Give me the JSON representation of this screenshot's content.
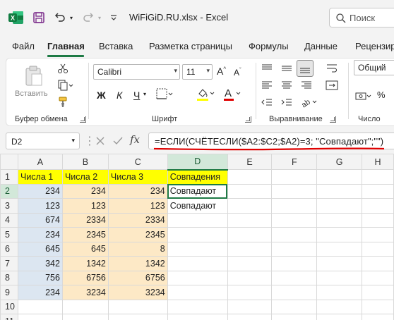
{
  "titlebar": {
    "title": "WiFiGiD.RU.xlsx  -  Excel",
    "search_placeholder": "Поиск"
  },
  "menu": {
    "items": [
      "Файл",
      "Главная",
      "Вставка",
      "Разметка страницы",
      "Формулы",
      "Данные",
      "Рецензиро"
    ],
    "active": "Главная"
  },
  "ribbon": {
    "clipboard": {
      "paste_label": "Вставить",
      "group_label": "Буфер обмена"
    },
    "font": {
      "font_name": "Calibri",
      "font_size": "11",
      "bold": "Ж",
      "italic": "К",
      "underline": "Ч",
      "group_label": "Шрифт",
      "font_color": "#e00000"
    },
    "alignment": {
      "group_label": "Выравнивание"
    },
    "number": {
      "format": "Общий",
      "group_label": "Число"
    }
  },
  "formula_bar": {
    "name_box": "D2",
    "formula": "=ЕСЛИ(СЧЁТЕСЛИ($A2:$C2;$A2)=3; \"Совпадают\";\"\")"
  },
  "sheet": {
    "columns": [
      "A",
      "B",
      "C",
      "D",
      "E",
      "F",
      "G",
      "H"
    ],
    "selected_column": "D",
    "selected_row": "2",
    "rows": [
      {
        "n": "1",
        "cells": [
          "Числа 1",
          "Числа 2",
          "Числа 3",
          "Совпадения"
        ]
      },
      {
        "n": "2",
        "cells": [
          "234",
          "234",
          "234",
          "Совпадают"
        ]
      },
      {
        "n": "3",
        "cells": [
          "123",
          "123",
          "123",
          "Совпадают"
        ]
      },
      {
        "n": "4",
        "cells": [
          "674",
          "2334",
          "2334",
          ""
        ]
      },
      {
        "n": "5",
        "cells": [
          "234",
          "2345",
          "2345",
          ""
        ]
      },
      {
        "n": "6",
        "cells": [
          "645",
          "645",
          "8",
          ""
        ]
      },
      {
        "n": "7",
        "cells": [
          "342",
          "1342",
          "1342",
          ""
        ]
      },
      {
        "n": "8",
        "cells": [
          "756",
          "6756",
          "6756",
          ""
        ]
      },
      {
        "n": "9",
        "cells": [
          "234",
          "3234",
          "3234",
          ""
        ]
      },
      {
        "n": "10",
        "cells": [
          "",
          "",
          "",
          ""
        ]
      },
      {
        "n": "11",
        "cells": [
          "",
          "",
          "",
          ""
        ]
      }
    ]
  },
  "colors": {
    "accent": "#1e7a45",
    "header_yellow": "#ffff00",
    "col_a_blue": "#dce6f1",
    "col_bc_orange": "#fde9c6",
    "annotation_red": "#e00000"
  }
}
